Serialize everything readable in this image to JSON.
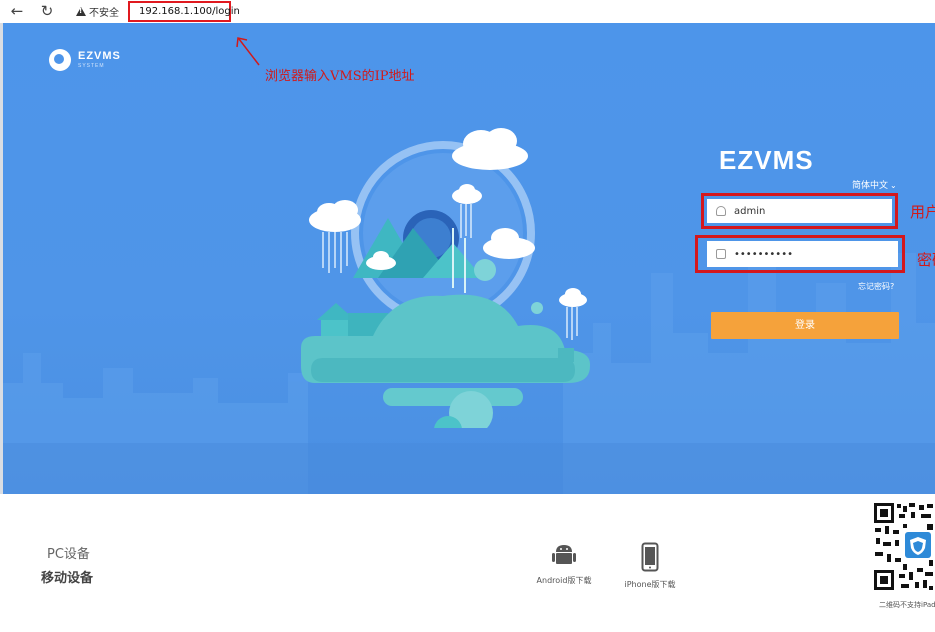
{
  "browser": {
    "back_icon": "arrow-left-icon",
    "reload_icon": "reload-icon",
    "security_text": "不安全",
    "url": "192.168.1.100/login"
  },
  "hero": {
    "logo_name": "EZVMS",
    "logo_sub": "SYSTEM",
    "annotation_text": "浏览器输入VMS的IP地址"
  },
  "login": {
    "brand": "EZVMS",
    "language": "简体中文",
    "username_value": "admin",
    "password_value": "••••••••••",
    "username_annotation": "用户",
    "password_annotation": "密码",
    "forgot_password": "忘记密码?",
    "login_button": "登录"
  },
  "footer": {
    "pc_label": "PC设备",
    "mobile_label": "移动设备",
    "android_label": "Android版下载",
    "iphone_label": "iPhone版下载",
    "qr_caption": "二维码不支持iPad"
  },
  "colors": {
    "hero_blue": "#4d95ea",
    "login_button": "#f5a23b",
    "annotation_red": "#d4171d"
  }
}
